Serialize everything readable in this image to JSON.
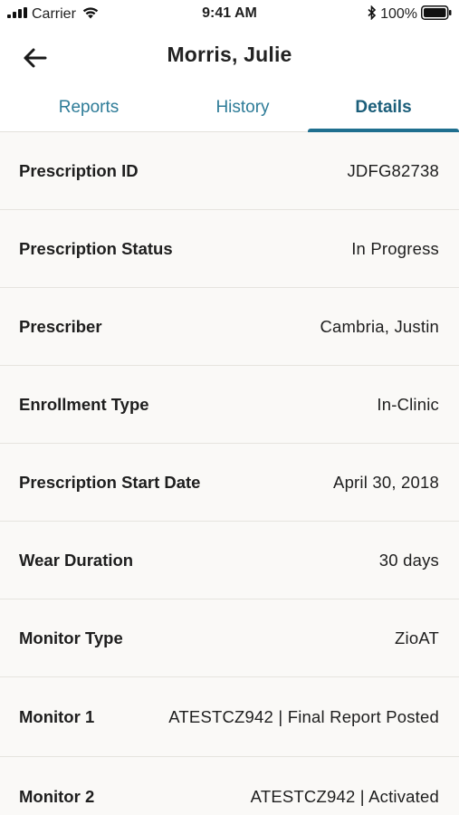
{
  "status_bar": {
    "carrier": "Carrier",
    "time": "9:41 AM",
    "battery": "100%"
  },
  "header": {
    "title": "Morris, Julie"
  },
  "tabs": [
    {
      "label": "Reports"
    },
    {
      "label": "History"
    },
    {
      "label": "Details",
      "active": true
    }
  ],
  "details": [
    {
      "label": "Prescription ID",
      "value": "JDFG82738"
    },
    {
      "label": "Prescription Status",
      "value": "In Progress"
    },
    {
      "label": "Prescriber",
      "value": "Cambria, Justin"
    },
    {
      "label": "Enrollment Type",
      "value": "In-Clinic"
    },
    {
      "label": "Prescription Start Date",
      "value": "April 30, 2018"
    },
    {
      "label": "Wear Duration",
      "value": "30 days"
    },
    {
      "label": "Monitor Type",
      "value": "ZioAT"
    },
    {
      "label": "Monitor 1",
      "value": "ATESTCZ942 | Final Report Posted"
    },
    {
      "label": "Monitor 2",
      "value": "ATESTCZ942 | Activated"
    }
  ],
  "colors": {
    "tab_text": "#2e7c98",
    "tab_active": "#1b5e7a",
    "tab_indicator": "#1f6f8f",
    "background": "#faf9f7"
  },
  "icons": {
    "signal": "signal-icon",
    "wifi": "wifi-icon",
    "bluetooth": "bluetooth-icon",
    "battery": "battery-icon",
    "back": "back-arrow-icon"
  }
}
